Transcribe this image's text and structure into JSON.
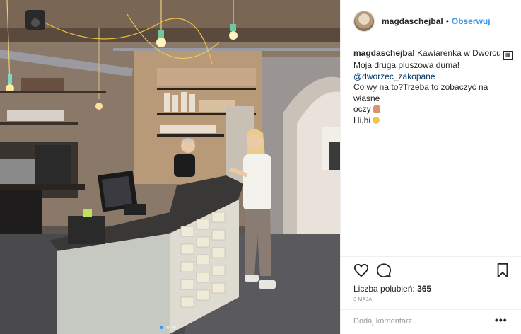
{
  "post": {
    "username": "magdaschejbal",
    "separator": "•",
    "follow_label": "Obserwuj",
    "avatar_icon": "avatar-photo",
    "caption": {
      "user": "magdaschejbal",
      "line1": "Kawiarenka w Dworcu",
      "line1_emoji": "▦",
      "line2": "Moja druga pluszowa duma!",
      "mention": "@dworzec_zakopane",
      "line4": "Co wy na to?Trzeba to zobaczyć na własne",
      "line5": "oczy",
      "line6": "Hi,hi"
    },
    "icons": {
      "like": "heart-icon",
      "comment": "comment-icon",
      "save": "bookmark-icon",
      "more": "more-icon"
    },
    "likes_label": "Liczba polubień:",
    "likes_count": "365",
    "date": "3 MAJA",
    "comment_placeholder": "Dodaj komentarz...",
    "more_label": "•••",
    "colors": {
      "accent": "#3897f0",
      "text": "#262626",
      "muted": "#999999",
      "border": "#efefef"
    }
  }
}
